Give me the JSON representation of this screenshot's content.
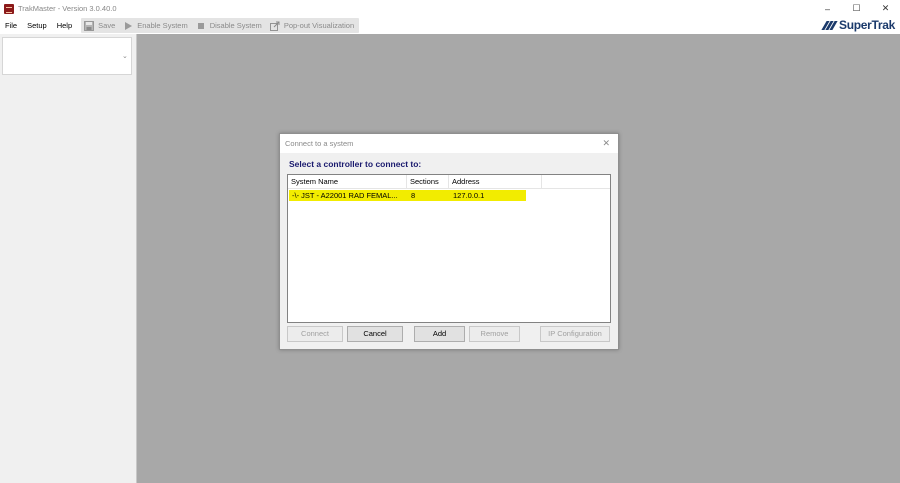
{
  "window": {
    "title": "TrakMaster - Version 3.0.40.0",
    "controls": {
      "minimize": "–",
      "maximize": "☐",
      "close": "✕"
    }
  },
  "menu": {
    "file": "File",
    "setup": "Setup",
    "help": "Help"
  },
  "toolbar": {
    "save": "Save",
    "enable_system": "Enable System",
    "disable_system": "Disable System",
    "popout": "Pop-out Visualization"
  },
  "brand": {
    "name": "SuperTrak"
  },
  "sidebar": {
    "combo_value": ""
  },
  "dialog": {
    "title": "Connect to a system",
    "close": "✕",
    "prompt": "Select a controller to connect to:",
    "columns": [
      "System Name",
      "Sections",
      "Address"
    ],
    "rows": [
      {
        "name": "-\\- JST - A22001 RAD FEMAL...",
        "sections": "8",
        "address": "127.0.0.1",
        "selected": true
      }
    ],
    "buttons": {
      "connect": "Connect",
      "cancel": "Cancel",
      "add": "Add",
      "remove": "Remove",
      "ip_config": "IP Configuration"
    }
  },
  "colors": {
    "workspace": "#a8a8a8",
    "selection": "#f2ec00",
    "brand": "#1b3a6b",
    "prompt": "#1a1a6e"
  }
}
